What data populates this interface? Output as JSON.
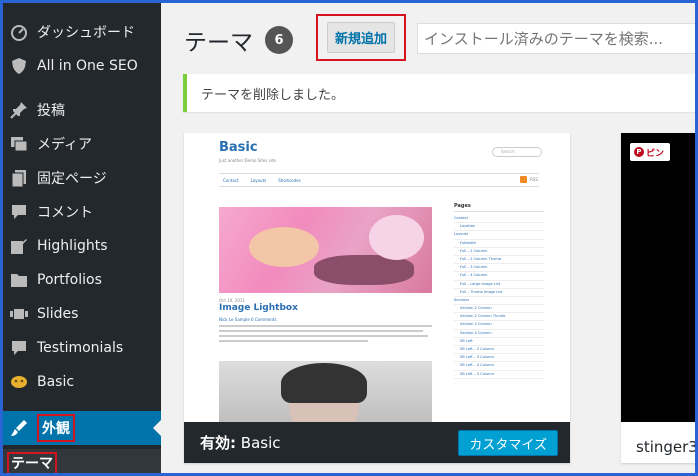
{
  "sidebar": {
    "items": [
      {
        "label": "ダッシュボード",
        "icon": "dashboard-icon"
      },
      {
        "label": "All in One SEO",
        "icon": "shield-icon"
      },
      {
        "label": "投稿",
        "icon": "pin-icon"
      },
      {
        "label": "メディア",
        "icon": "media-icon"
      },
      {
        "label": "固定ページ",
        "icon": "page-icon"
      },
      {
        "label": "コメント",
        "icon": "comment-icon"
      },
      {
        "label": "Highlights",
        "icon": "edit-icon"
      },
      {
        "label": "Portfolios",
        "icon": "folder-icon"
      },
      {
        "label": "Slides",
        "icon": "slides-icon"
      },
      {
        "label": "Testimonials",
        "icon": "comment-icon"
      },
      {
        "label": "Basic",
        "icon": "basic-icon"
      },
      {
        "label": "外観",
        "icon": "brush-icon"
      }
    ],
    "submenu": {
      "label": "テーマ"
    }
  },
  "header": {
    "title": "テーマ",
    "count": "6",
    "add_new": "新規追加",
    "search_placeholder": "インストール済みのテーマを検索..."
  },
  "notice": {
    "text": "テーマを削除しました。"
  },
  "theme_card": {
    "active_prefix": "有効:",
    "name": "Basic",
    "customize": "カスタマイズ",
    "screenshot": {
      "site_title": "Basic",
      "tagline": "Just another Demo Sites site",
      "search": "Search",
      "nav": [
        "Contact",
        "Layouts",
        "Shortcodes"
      ],
      "rss": "RSS",
      "date": "Oct 10, 2011",
      "post_title": "Image Lightbox",
      "meta": "Nick Le   Sample   0 Comments",
      "pages_heading": "Pages",
      "pages": [
        "Contact",
        "Location",
        "Layouts",
        "Fullwidth",
        "Full – 2 Column",
        "Full – 2 Column Thumb",
        "Full – 3 Column",
        "Full – 4 Column",
        "Full – Large Image List",
        "Full – Thumb Image List",
        "Sections",
        "Section 2 Column",
        "Section 2 Column Thumb",
        "Section 3 Column",
        "Section 4 Column",
        "SB Left",
        "SB Left – 2 Column",
        "SB Left – 3 Column",
        "SB Left – 4 Column",
        "SB Left – 5 Column"
      ]
    }
  },
  "theme_card_2": {
    "pin_label": "ピン",
    "name": "stinger3"
  },
  "colors": {
    "sidebar_bg": "#23282d",
    "active_bg": "#0073aa",
    "highlight_red": "#d4141e",
    "frame_blue": "#2a63d4",
    "notice_green": "#7ad03a",
    "customize_blue": "#00a0d2"
  }
}
